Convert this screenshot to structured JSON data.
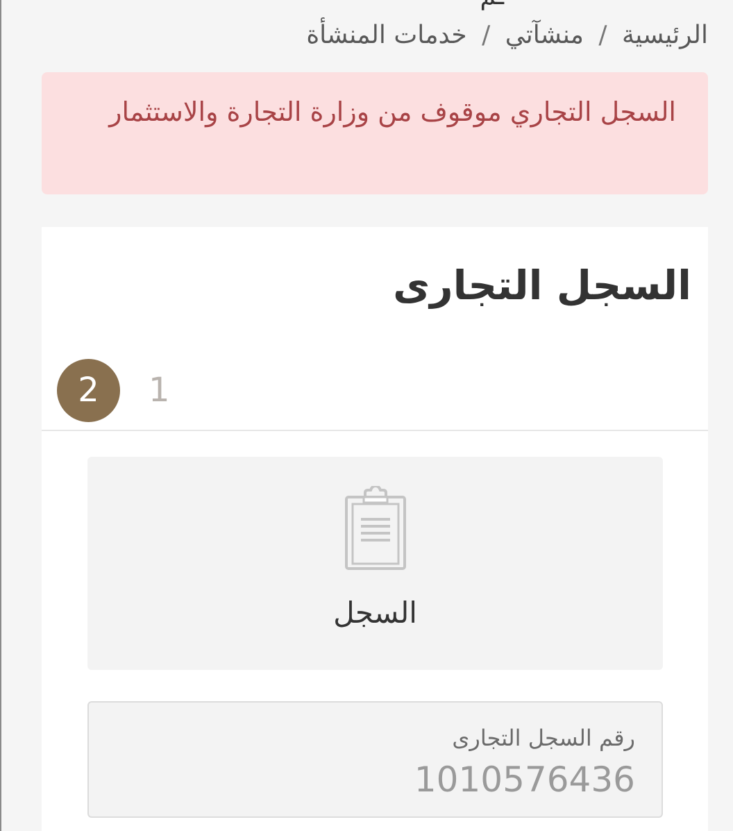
{
  "page": {
    "title_partial": "ـم"
  },
  "breadcrumb": {
    "items": [
      "الرئيسية",
      "منشآتي",
      "خدمات المنشأة"
    ],
    "separator": "/"
  },
  "alert": {
    "message": "السجل التجاري موقوف من وزارة التجارة والاستثمار"
  },
  "card": {
    "title": "السجل التجارى",
    "steps": {
      "active": "2",
      "inactive": "1"
    },
    "document_tile": {
      "icon": "clipboard-icon",
      "label": "السجل"
    },
    "field": {
      "label": "رقم السجل التجارى",
      "value": "1010576436"
    }
  },
  "colors": {
    "step_active": "#89704f",
    "alert_bg": "#fcdfe0",
    "alert_text": "#a84346"
  }
}
